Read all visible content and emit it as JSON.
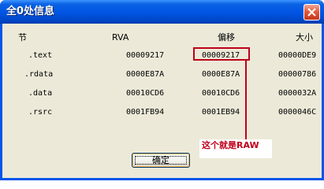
{
  "window": {
    "title": "全0处信息",
    "close_label": "×"
  },
  "table": {
    "headers": {
      "section": "节",
      "rva": "RVA",
      "offset": "偏移",
      "size": "大小"
    },
    "rows": [
      {
        "section": ".text",
        "rva": "00009217",
        "offset": "00009217",
        "size": "00000DE9"
      },
      {
        "section": ".rdata",
        "rva": "0000E87A",
        "offset": "0000E87A",
        "size": "00000786"
      },
      {
        "section": ".data",
        "rva": "00010CD6",
        "offset": "00010CD6",
        "size": "0000032A"
      },
      {
        "section": ".rsrc",
        "rva": "0001FB94",
        "offset": "0001EB94",
        "size": "0000046C"
      }
    ]
  },
  "annotation": {
    "text": "这个就是RAW",
    "color": "#c0001a"
  },
  "button": {
    "ok_label": "确定"
  },
  "colors": {
    "title_bar": "#0054e3",
    "dialog_bg": "#ece9d8",
    "highlight": "#c0001a"
  }
}
